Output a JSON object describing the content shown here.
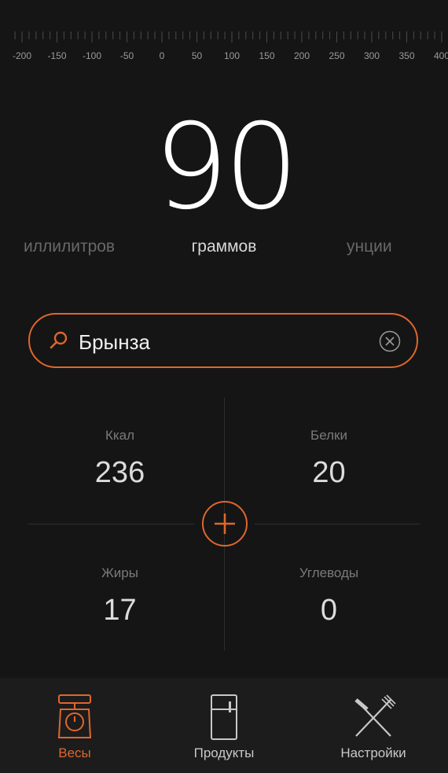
{
  "ruler": {
    "labels": [
      "-200",
      "-150",
      "-100",
      "-50",
      "0",
      "50",
      "100",
      "150",
      "200",
      "250",
      "300",
      "350",
      "400"
    ]
  },
  "display": {
    "weight": "90",
    "unit_left": "иллилитров",
    "unit_center": "граммов",
    "unit_right": "унции"
  },
  "search": {
    "value": "Брынза"
  },
  "nutrition": {
    "kcal_label": "Ккал",
    "kcal_value": "236",
    "protein_label": "Белки",
    "protein_value": "20",
    "fat_label": "Жиры",
    "fat_value": "17",
    "carbs_label": "Углеводы",
    "carbs_value": "0"
  },
  "tabs": [
    {
      "label": "Весы",
      "icon": "scale-icon",
      "active": true
    },
    {
      "label": "Продукты",
      "icon": "fridge-icon",
      "active": false
    },
    {
      "label": "Настройки",
      "icon": "fork-knife-icon",
      "active": false
    }
  ],
  "colors": {
    "accent": "#e0662c",
    "background": "#151515"
  }
}
